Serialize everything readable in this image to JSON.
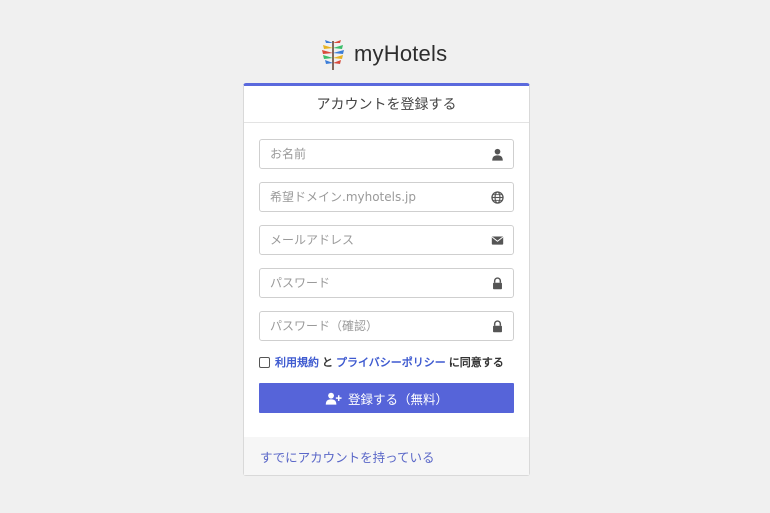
{
  "brand": {
    "name": "myHotels",
    "icon": "palm-leaf-logo-icon"
  },
  "form": {
    "title": "アカウントを登録する",
    "fields": [
      {
        "placeholder": "お名前",
        "value": "",
        "icon": "user-icon"
      },
      {
        "placeholder": "希望ドメイン.myhotels.jp",
        "value": "",
        "icon": "globe-icon"
      },
      {
        "placeholder": "メールアドレス",
        "value": "",
        "icon": "envelope-icon"
      },
      {
        "placeholder": "パスワード",
        "value": "",
        "icon": "lock-icon"
      },
      {
        "placeholder": "パスワード（確認）",
        "value": "",
        "icon": "lock-icon"
      }
    ],
    "agree": {
      "checked": false,
      "terms_link": "利用規約",
      "and": "と",
      "privacy_link": "プライバシーポリシー",
      "suffix": "に同意する"
    },
    "submit_label": "登録する（無料）",
    "submit_icon": "user-plus-icon"
  },
  "footer": {
    "login_link": "すでにアカウントを持っている"
  },
  "colors": {
    "accent": "#5664d9",
    "link": "#5a67c8",
    "background": "#f0f0f0"
  }
}
